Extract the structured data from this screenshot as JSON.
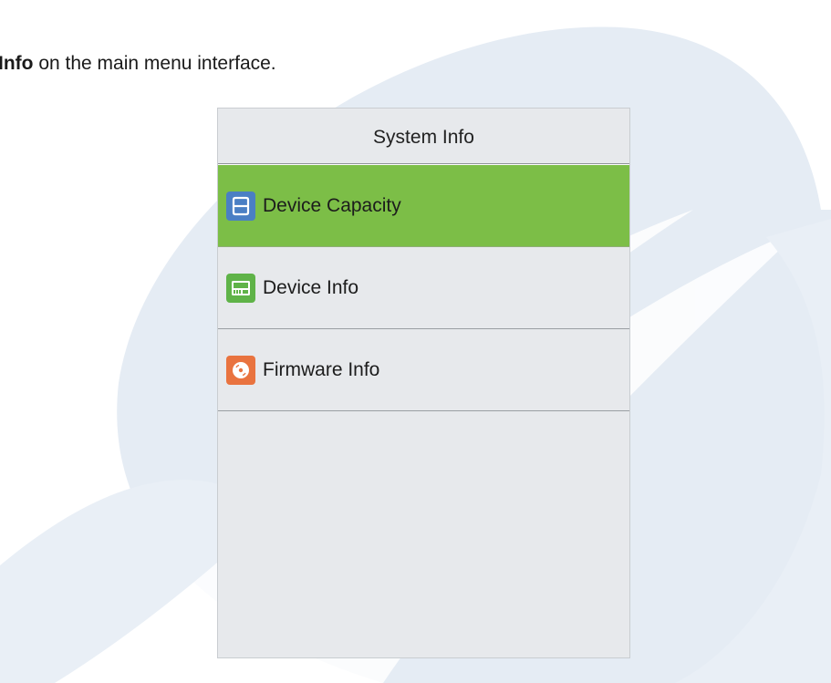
{
  "instruction": {
    "bold_text": "Info",
    "rest_text": " on the main menu interface."
  },
  "screen": {
    "title": "System Info",
    "menu_items": [
      {
        "label": "Device Capacity",
        "icon": "sd-card-icon",
        "icon_color": "#4a7fc4",
        "selected": true
      },
      {
        "label": "Device Info",
        "icon": "device-icon",
        "icon_color": "#5fb348",
        "selected": false
      },
      {
        "label": "Firmware Info",
        "icon": "disc-icon",
        "icon_color": "#e9733f",
        "selected": false
      }
    ],
    "selected_color": "#7cbe47"
  }
}
